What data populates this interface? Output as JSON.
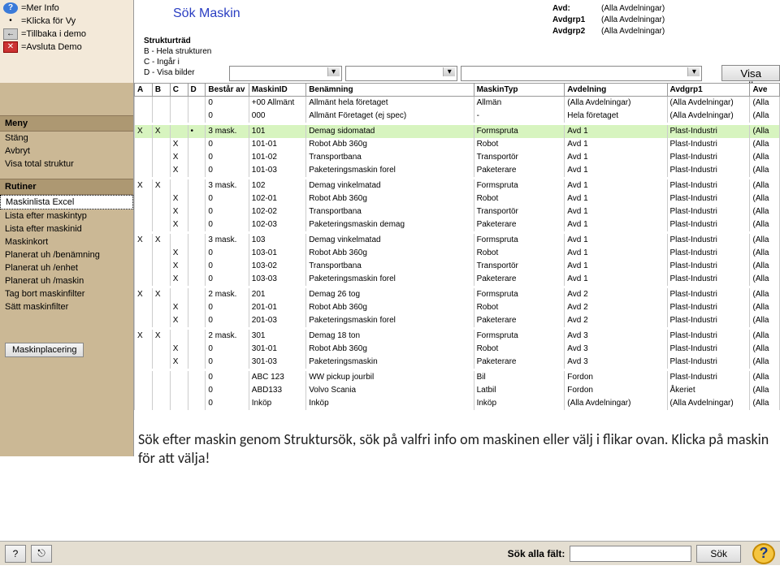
{
  "legend": {
    "more": "=Mer Info",
    "click": "=Klicka för Vy",
    "back": "=Tillbaka i demo",
    "quit": "=Avsluta Demo"
  },
  "title": "Sök Maskin",
  "filters_right": {
    "avd_lbl": "Avd:",
    "avd_val": "(Alla Avdelningar)",
    "g1_lbl": "Avdgrp1",
    "g1_val": "(Alla Avdelningar)",
    "g2_lbl": "Avdgrp2",
    "g2_val": "(Alla Avdelningar)"
  },
  "struct": {
    "title": "Strukturträd",
    "b": "B - Hela strukturen",
    "c": "C - Ingår i",
    "d": "D - Visa bilder"
  },
  "btn_visa_alla": "Visa alla",
  "sidebar": {
    "meny": "Meny",
    "stang": "Stäng",
    "avbryt": "Avbryt",
    "visa": "Visa total struktur",
    "rutiner": "Rutiner",
    "excel": "Maskinlista Excel",
    "mtyp": "Lista efter maskintyp",
    "mid": "Lista efter maskinid",
    "kort": "Maskinkort",
    "ben": "Planerat uh /benämning",
    "enh": "Planerat uh /enhet",
    "mas": "Planerat uh /maskin",
    "tag": "Tag bort maskinfilter",
    "satt": "Sätt maskinfilter",
    "plac": "Maskinplacering"
  },
  "columns": {
    "a": "A",
    "b": "B",
    "c": "C",
    "d": "D",
    "bestar": "Består av",
    "maskinid": "MaskinID",
    "benamning": "Benämning",
    "typ": "MaskinTyp",
    "avd": "Avdelning",
    "grp1": "Avdgrp1",
    "ave": "Ave"
  },
  "rows": [
    {
      "a": "",
      "b": "",
      "c": "",
      "d": "",
      "bestar": "0",
      "mid": "+00 Allmänt",
      "ben": "Allmänt hela företaget",
      "typ": "Allmän",
      "avd": "(Alla Avdelningar)",
      "grp": "(Alla Avdelningar)",
      "ave": "(Alla"
    },
    {
      "a": "",
      "b": "",
      "c": "",
      "d": "",
      "bestar": "0",
      "mid": "000",
      "ben": "Allmänt Företaget (ej spec)",
      "typ": "-",
      "avd": "Hela företaget",
      "grp": "(Alla Avdelningar)",
      "ave": "(Alla"
    },
    {
      "hl": true,
      "a": "X",
      "b": "X",
      "c": "",
      "d": "•",
      "bestar": "3 mask.",
      "mid": "101",
      "ben": "Demag sidomatad",
      "typ": "Formspruta",
      "avd": "Avd 1",
      "grp": "Plast-Industri",
      "ave": "(Alla"
    },
    {
      "a": "",
      "b": "",
      "c": "X",
      "d": "",
      "bestar": "0",
      "mid": "101-01",
      "ben": "Robot Abb 360g",
      "typ": "Robot",
      "avd": "Avd 1",
      "grp": "Plast-Industri",
      "ave": "(Alla"
    },
    {
      "a": "",
      "b": "",
      "c": "X",
      "d": "",
      "bestar": "0",
      "mid": "101-02",
      "ben": "Transportbana",
      "typ": "Transportör",
      "avd": "Avd 1",
      "grp": "Plast-Industri",
      "ave": "(Alla"
    },
    {
      "a": "",
      "b": "",
      "c": "X",
      "d": "",
      "bestar": "0",
      "mid": "101-03",
      "ben": "Paketeringsmaskin forel",
      "typ": "Paketerare",
      "avd": "Avd 1",
      "grp": "Plast-Industri",
      "ave": "(Alla"
    },
    {
      "a": "X",
      "b": "X",
      "c": "",
      "d": "",
      "bestar": "3 mask.",
      "mid": "102",
      "ben": "Demag vinkelmatad",
      "typ": "Formspruta",
      "avd": "Avd 1",
      "grp": "Plast-Industri",
      "ave": "(Alla"
    },
    {
      "a": "",
      "b": "",
      "c": "X",
      "d": "",
      "bestar": "0",
      "mid": "102-01",
      "ben": "Robot Abb 360g",
      "typ": "Robot",
      "avd": "Avd 1",
      "grp": "Plast-Industri",
      "ave": "(Alla"
    },
    {
      "a": "",
      "b": "",
      "c": "X",
      "d": "",
      "bestar": "0",
      "mid": "102-02",
      "ben": "Transportbana",
      "typ": "Transportör",
      "avd": "Avd 1",
      "grp": "Plast-Industri",
      "ave": "(Alla"
    },
    {
      "a": "",
      "b": "",
      "c": "X",
      "d": "",
      "bestar": "0",
      "mid": "102-03",
      "ben": "Paketeringsmaskin demag",
      "typ": "Paketerare",
      "avd": "Avd 1",
      "grp": "Plast-Industri",
      "ave": "(Alla"
    },
    {
      "a": "X",
      "b": "X",
      "c": "",
      "d": "",
      "bestar": "3 mask.",
      "mid": "103",
      "ben": "Demag vinkelmatad",
      "typ": "Formspruta",
      "avd": "Avd 1",
      "grp": "Plast-Industri",
      "ave": "(Alla"
    },
    {
      "a": "",
      "b": "",
      "c": "X",
      "d": "",
      "bestar": "0",
      "mid": "103-01",
      "ben": "Robot Abb 360g",
      "typ": "Robot",
      "avd": "Avd 1",
      "grp": "Plast-Industri",
      "ave": "(Alla"
    },
    {
      "a": "",
      "b": "",
      "c": "X",
      "d": "",
      "bestar": "0",
      "mid": "103-02",
      "ben": "Transportbana",
      "typ": "Transportör",
      "avd": "Avd 1",
      "grp": "Plast-Industri",
      "ave": "(Alla"
    },
    {
      "a": "",
      "b": "",
      "c": "X",
      "d": "",
      "bestar": "0",
      "mid": "103-03",
      "ben": "Paketeringsmaskin forel",
      "typ": "Paketerare",
      "avd": "Avd 1",
      "grp": "Plast-Industri",
      "ave": "(Alla"
    },
    {
      "a": "X",
      "b": "X",
      "c": "",
      "d": "",
      "bestar": "2 mask.",
      "mid": "201",
      "ben": "Demag 26 tog",
      "typ": "Formspruta",
      "avd": "Avd 2",
      "grp": "Plast-Industri",
      "ave": "(Alla"
    },
    {
      "a": "",
      "b": "",
      "c": "X",
      "d": "",
      "bestar": "0",
      "mid": "201-01",
      "ben": "Robot Abb 360g",
      "typ": "Robot",
      "avd": "Avd 2",
      "grp": "Plast-Industri",
      "ave": "(Alla"
    },
    {
      "a": "",
      "b": "",
      "c": "X",
      "d": "",
      "bestar": "0",
      "mid": "201-03",
      "ben": "Paketeringsmaskin forel",
      "typ": "Paketerare",
      "avd": "Avd 2",
      "grp": "Plast-Industri",
      "ave": "(Alla"
    },
    {
      "a": "X",
      "b": "X",
      "c": "",
      "d": "",
      "bestar": "2 mask.",
      "mid": "301",
      "ben": "Demag 18 ton",
      "typ": "Formspruta",
      "avd": "Avd 3",
      "grp": "Plast-Industri",
      "ave": "(Alla"
    },
    {
      "a": "",
      "b": "",
      "c": "X",
      "d": "",
      "bestar": "0",
      "mid": "301-01",
      "ben": "Robot Abb 360g",
      "typ": "Robot",
      "avd": "Avd 3",
      "grp": "Plast-Industri",
      "ave": "(Alla"
    },
    {
      "a": "",
      "b": "",
      "c": "X",
      "d": "",
      "bestar": "0",
      "mid": "301-03",
      "ben": "Paketeringsmaskin",
      "typ": "Paketerare",
      "avd": "Avd 3",
      "grp": "Plast-Industri",
      "ave": "(Alla"
    },
    {
      "a": "",
      "b": "",
      "c": "",
      "d": "",
      "bestar": "0",
      "mid": "ABC 123",
      "ben": "WW pickup jourbil",
      "typ": "Bil",
      "avd": "Fordon",
      "grp": "Plast-Industri",
      "ave": "(Alla"
    },
    {
      "a": "",
      "b": "",
      "c": "",
      "d": "",
      "bestar": "0",
      "mid": "ABD133",
      "ben": "Volvo Scania",
      "typ": "Latbil",
      "avd": "Fordon",
      "grp": "Åkeriet",
      "ave": "(Alla"
    },
    {
      "a": "",
      "b": "",
      "c": "",
      "d": "",
      "bestar": "0",
      "mid": "Inköp",
      "ben": "Inköp",
      "typ": "Inköp",
      "avd": "(Alla Avdelningar)",
      "grp": "(Alla Avdelningar)",
      "ave": "(Alla"
    }
  ],
  "instruction": "Sök efter maskin genom Struktursök, sök på valfri info om maskinen eller välj i flikar ovan. Klicka på maskin för att välja!",
  "bottombar": {
    "label": "Sök alla fält:",
    "sok": "Sök"
  }
}
